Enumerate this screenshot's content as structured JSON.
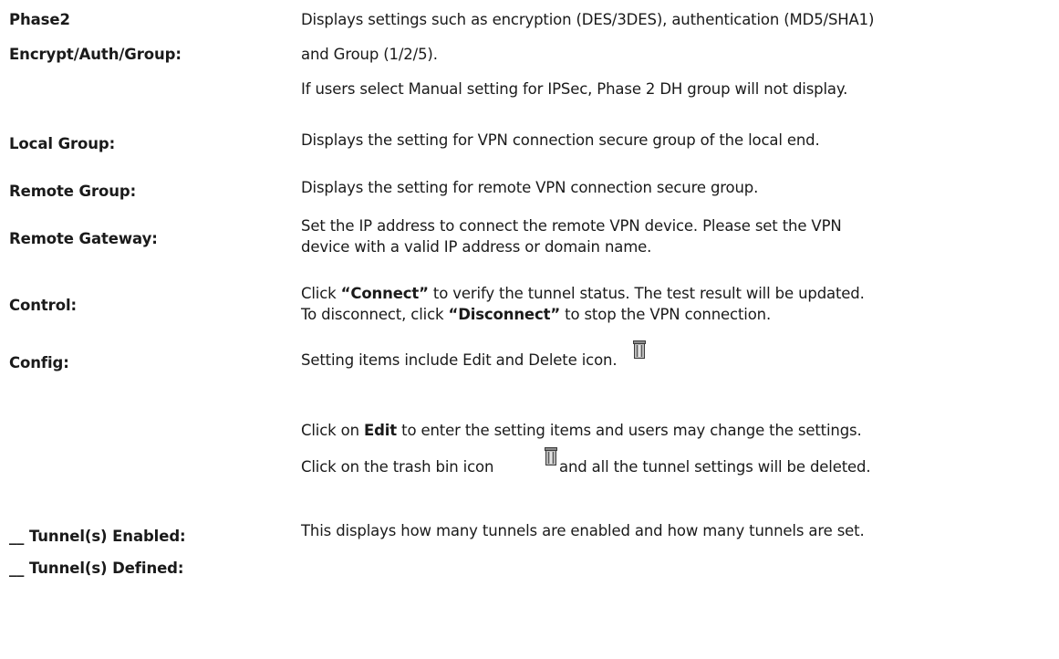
{
  "rows": [
    {
      "label": "Phase2",
      "label2": "Encrypt/Auth/Group:",
      "desc1": "Displays settings such as encryption (DES/3DES), authentication (MD5/SHA1)",
      "desc2": "and Group (1/2/5).",
      "desc3": "If users select Manual setting for IPSec, Phase 2 DH group will not display."
    },
    {
      "label": "Local Group:",
      "desc1": "Displays the setting for VPN connection secure group of the local end."
    },
    {
      "label": "Remote Group:",
      "desc1": "Displays the setting for remote VPN connection secure group."
    },
    {
      "label": "Remote Gateway:",
      "desc1": "Set the IP address to connect the remote VPN device. Please set the VPN",
      "desc2": "device with a valid IP address or domain name."
    },
    {
      "label": "Control:",
      "desc1_pre": "Click ",
      "desc1_bold": "“Connect”",
      "desc1_post": " to verify the tunnel status. The test result will be updated.",
      "desc2_pre": "To disconnect, click ",
      "desc2_bold": "“Disconnect”",
      "desc2_post": " to stop the VPN connection."
    },
    {
      "label": "Config:",
      "desc1": "Setting items include Edit and Delete icon.",
      "desc2_pre": "Click on ",
      "desc2_bold": "Edit",
      "desc2_post": " to enter the setting items and users may change the settings.",
      "desc3_pre": "Click on the trash bin icon",
      "desc3_post": "and all the tunnel settings will be deleted."
    },
    {
      "label": "__ Tunnel(s) Enabled:",
      "label2": "__ Tunnel(s) Defined:",
      "desc1": "This displays how many tunnels are enabled and how many tunnels are set."
    }
  ],
  "icons": {
    "trash": "trash-bin-icon"
  }
}
